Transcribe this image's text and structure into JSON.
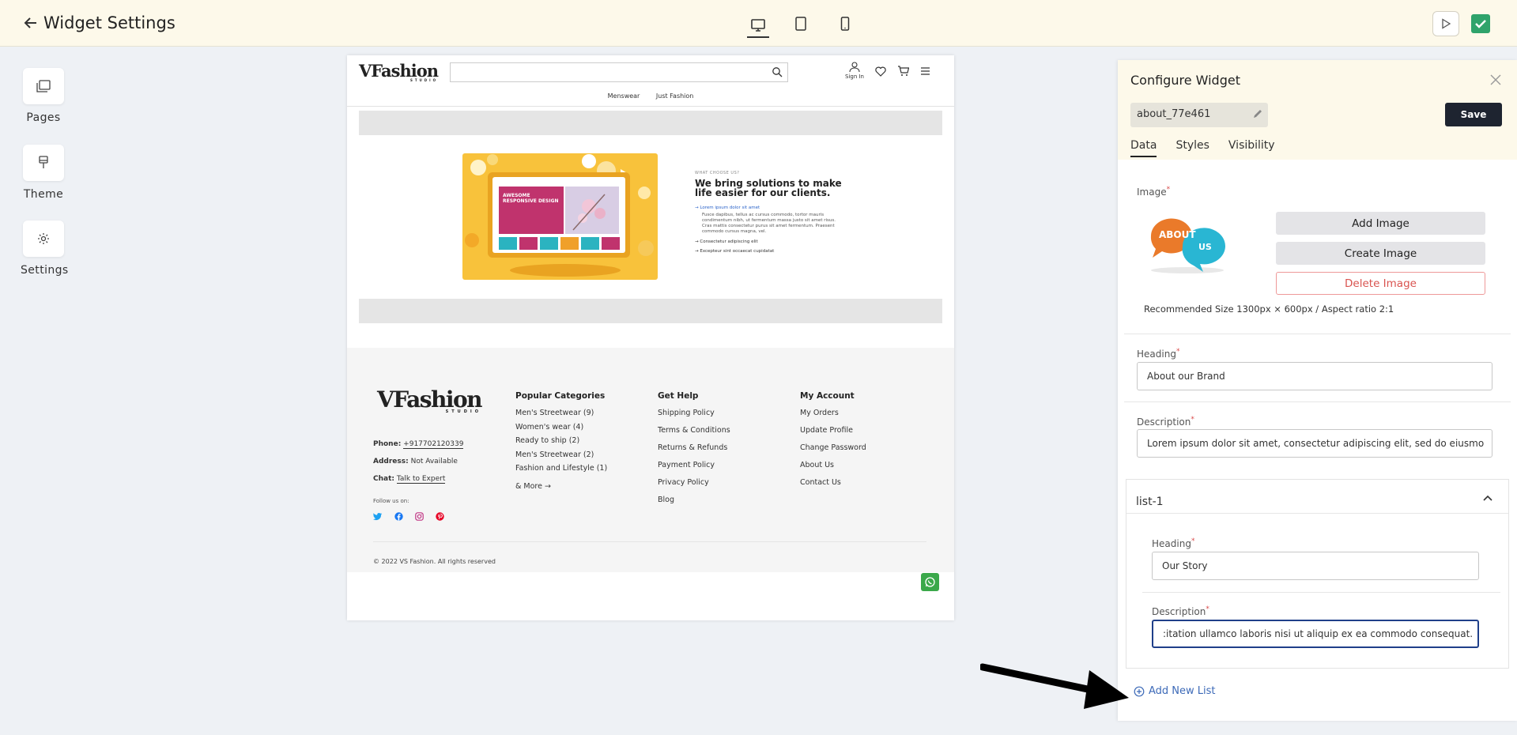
{
  "header": {
    "title": "Widget Settings",
    "back_icon": "arrow-left-icon",
    "devices": [
      "desktop-icon",
      "tablet-icon",
      "mobile-icon"
    ],
    "active_device": "desktop"
  },
  "sidebar": {
    "items": [
      {
        "label": "Pages",
        "icon": "pages-icon"
      },
      {
        "label": "Theme",
        "icon": "brush-icon"
      },
      {
        "label": "Settings",
        "icon": "gear-icon"
      }
    ]
  },
  "preview": {
    "logo_text": "VFashion",
    "logo_sub": "STUDIO",
    "sign_in": "Sign In",
    "nav": [
      "Menswear",
      "Just Fashion"
    ],
    "hero": {
      "kicker": "WHAT CHOOSE US?",
      "heading": "We bring solutions to make life easier for our clients.",
      "items": [
        {
          "title": "Lorem ipsum dolor sit amet",
          "text": "Fusce dapibus, tellus ac cursus commodo, tortor mauris condimentum nibh, ut fermentum massa justo sit amet risus. Cras mattis consectetur purus sit amet fermentum. Praesent commodo cursus magna, vel."
        },
        {
          "title": "Consectetur adipiscing elit",
          "text": ""
        },
        {
          "title": "Excepteur sint occaecat cupidatat",
          "text": ""
        }
      ],
      "screen_text": "AWESOME RESPONSIVE DESIGN"
    },
    "footer": {
      "logo_text": "VFashion",
      "logo_sub": "STUDIO",
      "phone_label": "Phone:",
      "phone": "+917702120339",
      "address_label": "Address:",
      "address": "Not Available",
      "chat_label": "Chat:",
      "chat": "Talk to Expert",
      "follow": "Follow us on:",
      "columns": [
        {
          "title": "Popular Categories",
          "links": [
            "Men's Streetwear (9)",
            "Women's wear (4)",
            "Ready to ship (2)",
            "Men's Streetwear (2)",
            "Fashion and Lifestyle (1)"
          ],
          "more": "& More"
        },
        {
          "title": "Get Help",
          "links": [
            "Shipping Policy",
            "Terms & Conditions",
            "Returns & Refunds",
            "Payment Policy",
            "Privacy Policy",
            "Blog"
          ]
        },
        {
          "title": "My Account",
          "links": [
            "My Orders",
            "Update Profile",
            "Change Password",
            "About Us",
            "Contact Us"
          ]
        }
      ],
      "copyright": "© 2022 VS Fashion. All rights reserved"
    }
  },
  "panel": {
    "title": "Configure Widget",
    "widget_id": "about_77e461",
    "save_label": "Save",
    "tabs": [
      "Data",
      "Styles",
      "Visibility"
    ],
    "active_tab": "Data",
    "image_label": "Image",
    "image_text_left": "ABOUT",
    "image_text_right": "US",
    "add_image": "Add Image",
    "create_image": "Create Image",
    "delete_image": "Delete Image",
    "recommended": "Recommended Size 1300px × 600px / Aspect ratio 2:1",
    "heading_label": "Heading",
    "heading_value": "About our Brand",
    "description_label": "Description",
    "description_value": "Lorem ipsum dolor sit amet, consectetur adipiscing elit, sed do eiusmo",
    "list": {
      "title": "list-1",
      "heading_label": "Heading",
      "heading_value": "Our Story",
      "description_label": "Description",
      "description_value": ":itation ullamco laboris nisi ut aliquip ex ea commodo consequat."
    },
    "add_new_list": "Add New List",
    "required_mark": "*"
  },
  "colors": {
    "topbar_bg": "#fdf9ea",
    "save_bg": "#1e2430",
    "link_blue": "#3d6ab8",
    "delete_red": "#d9534f",
    "whatsapp_green": "#3aa84a"
  }
}
